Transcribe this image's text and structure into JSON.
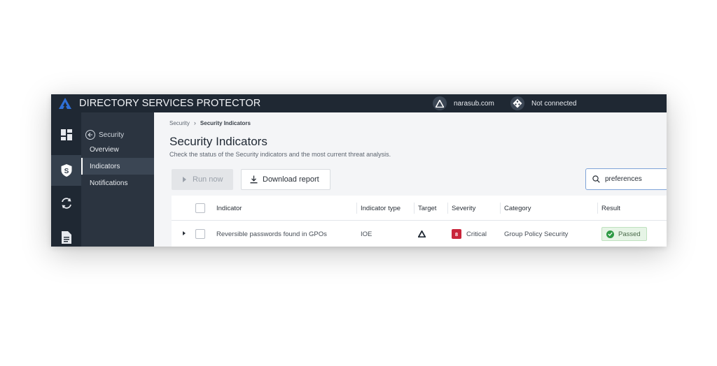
{
  "app": {
    "title": "DIRECTORY SERVICES PROTECTOR",
    "domain": "narasub.com",
    "connection_status": "Not connected",
    "colors": {
      "chrome": "#1f2833",
      "accent": "#2f6fd6",
      "critical": "#c9243a",
      "passed": "#2e9a45"
    }
  },
  "rail": {
    "items": [
      {
        "icon": "dashboard-icon"
      },
      {
        "icon": "shield-s-icon",
        "active": true
      },
      {
        "icon": "sync-icon"
      },
      {
        "icon": "document-icon"
      }
    ]
  },
  "subnav": {
    "back_label": "Security",
    "items": [
      {
        "label": "Overview"
      },
      {
        "label": "Indicators",
        "active": true
      },
      {
        "label": "Notifications"
      }
    ]
  },
  "breadcrumb": {
    "root": "Security",
    "current": "Security Indicators"
  },
  "page": {
    "title": "Security Indicators",
    "subtitle": "Check the status of the Security indicators and the most current threat analysis."
  },
  "toolbar": {
    "run_label": "Run now",
    "download_label": "Download report"
  },
  "search": {
    "value": "preferences",
    "placeholder": ""
  },
  "table": {
    "columns": [
      "Indicator",
      "Indicator type",
      "Target",
      "Severity",
      "Category",
      "Result"
    ],
    "rows": [
      {
        "indicator": "Reversible passwords found in GPOs",
        "type": "IOE",
        "target_icon": "ad-triangle-icon",
        "severity_value": "8",
        "severity": "Critical",
        "category": "Group Policy Security",
        "result": "Passed"
      }
    ]
  }
}
